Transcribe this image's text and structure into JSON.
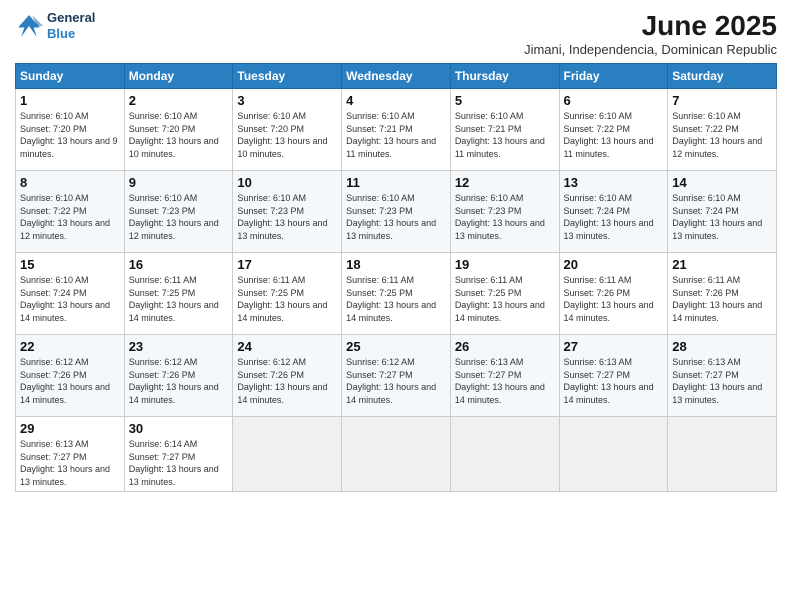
{
  "logo": {
    "line1": "General",
    "line2": "Blue"
  },
  "header": {
    "title": "June 2025",
    "subtitle": "Jimani, Independencia, Dominican Republic"
  },
  "days_of_week": [
    "Sunday",
    "Monday",
    "Tuesday",
    "Wednesday",
    "Thursday",
    "Friday",
    "Saturday"
  ],
  "weeks": [
    [
      {
        "day": "1",
        "sunrise": "6:10 AM",
        "sunset": "7:20 PM",
        "daylight": "13 hours and 9 minutes."
      },
      {
        "day": "2",
        "sunrise": "6:10 AM",
        "sunset": "7:20 PM",
        "daylight": "13 hours and 10 minutes."
      },
      {
        "day": "3",
        "sunrise": "6:10 AM",
        "sunset": "7:20 PM",
        "daylight": "13 hours and 10 minutes."
      },
      {
        "day": "4",
        "sunrise": "6:10 AM",
        "sunset": "7:21 PM",
        "daylight": "13 hours and 11 minutes."
      },
      {
        "day": "5",
        "sunrise": "6:10 AM",
        "sunset": "7:21 PM",
        "daylight": "13 hours and 11 minutes."
      },
      {
        "day": "6",
        "sunrise": "6:10 AM",
        "sunset": "7:22 PM",
        "daylight": "13 hours and 11 minutes."
      },
      {
        "day": "7",
        "sunrise": "6:10 AM",
        "sunset": "7:22 PM",
        "daylight": "13 hours and 12 minutes."
      }
    ],
    [
      {
        "day": "8",
        "sunrise": "6:10 AM",
        "sunset": "7:22 PM",
        "daylight": "13 hours and 12 minutes."
      },
      {
        "day": "9",
        "sunrise": "6:10 AM",
        "sunset": "7:23 PM",
        "daylight": "13 hours and 12 minutes."
      },
      {
        "day": "10",
        "sunrise": "6:10 AM",
        "sunset": "7:23 PM",
        "daylight": "13 hours and 13 minutes."
      },
      {
        "day": "11",
        "sunrise": "6:10 AM",
        "sunset": "7:23 PM",
        "daylight": "13 hours and 13 minutes."
      },
      {
        "day": "12",
        "sunrise": "6:10 AM",
        "sunset": "7:23 PM",
        "daylight": "13 hours and 13 minutes."
      },
      {
        "day": "13",
        "sunrise": "6:10 AM",
        "sunset": "7:24 PM",
        "daylight": "13 hours and 13 minutes."
      },
      {
        "day": "14",
        "sunrise": "6:10 AM",
        "sunset": "7:24 PM",
        "daylight": "13 hours and 13 minutes."
      }
    ],
    [
      {
        "day": "15",
        "sunrise": "6:10 AM",
        "sunset": "7:24 PM",
        "daylight": "13 hours and 14 minutes."
      },
      {
        "day": "16",
        "sunrise": "6:11 AM",
        "sunset": "7:25 PM",
        "daylight": "13 hours and 14 minutes."
      },
      {
        "day": "17",
        "sunrise": "6:11 AM",
        "sunset": "7:25 PM",
        "daylight": "13 hours and 14 minutes."
      },
      {
        "day": "18",
        "sunrise": "6:11 AM",
        "sunset": "7:25 PM",
        "daylight": "13 hours and 14 minutes."
      },
      {
        "day": "19",
        "sunrise": "6:11 AM",
        "sunset": "7:25 PM",
        "daylight": "13 hours and 14 minutes."
      },
      {
        "day": "20",
        "sunrise": "6:11 AM",
        "sunset": "7:26 PM",
        "daylight": "13 hours and 14 minutes."
      },
      {
        "day": "21",
        "sunrise": "6:11 AM",
        "sunset": "7:26 PM",
        "daylight": "13 hours and 14 minutes."
      }
    ],
    [
      {
        "day": "22",
        "sunrise": "6:12 AM",
        "sunset": "7:26 PM",
        "daylight": "13 hours and 14 minutes."
      },
      {
        "day": "23",
        "sunrise": "6:12 AM",
        "sunset": "7:26 PM",
        "daylight": "13 hours and 14 minutes."
      },
      {
        "day": "24",
        "sunrise": "6:12 AM",
        "sunset": "7:26 PM",
        "daylight": "13 hours and 14 minutes."
      },
      {
        "day": "25",
        "sunrise": "6:12 AM",
        "sunset": "7:27 PM",
        "daylight": "13 hours and 14 minutes."
      },
      {
        "day": "26",
        "sunrise": "6:13 AM",
        "sunset": "7:27 PM",
        "daylight": "13 hours and 14 minutes."
      },
      {
        "day": "27",
        "sunrise": "6:13 AM",
        "sunset": "7:27 PM",
        "daylight": "13 hours and 14 minutes."
      },
      {
        "day": "28",
        "sunrise": "6:13 AM",
        "sunset": "7:27 PM",
        "daylight": "13 hours and 13 minutes."
      }
    ],
    [
      {
        "day": "29",
        "sunrise": "6:13 AM",
        "sunset": "7:27 PM",
        "daylight": "13 hours and 13 minutes."
      },
      {
        "day": "30",
        "sunrise": "6:14 AM",
        "sunset": "7:27 PM",
        "daylight": "13 hours and 13 minutes."
      },
      null,
      null,
      null,
      null,
      null
    ]
  ]
}
